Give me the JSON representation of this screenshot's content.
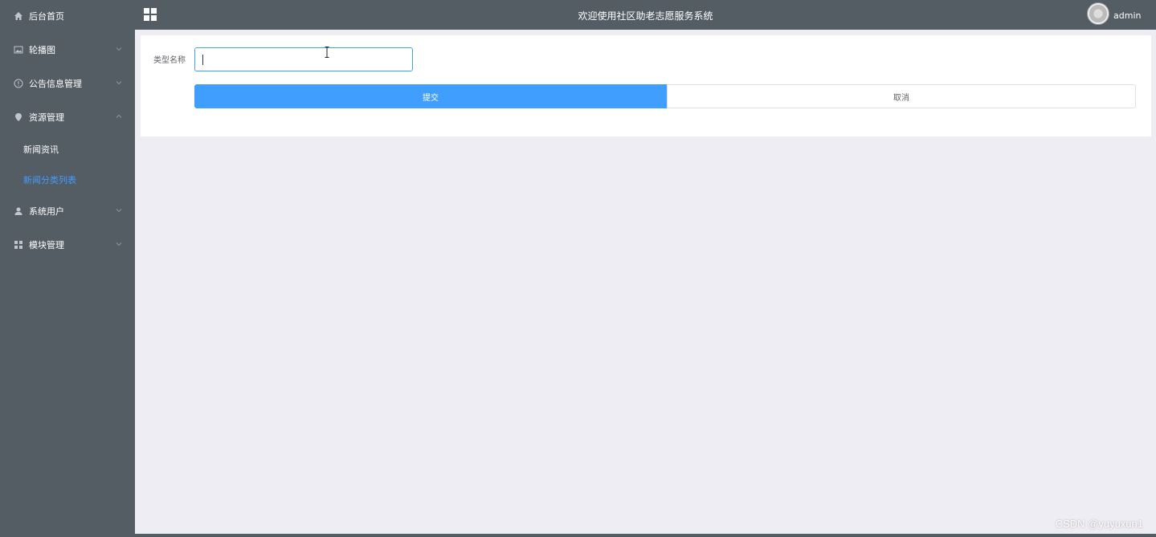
{
  "sidebar": {
    "items": [
      {
        "label": "后台首页",
        "icon": "home-icon"
      },
      {
        "label": "轮播图",
        "icon": "picture-icon"
      },
      {
        "label": "公告信息管理",
        "icon": "info-icon"
      },
      {
        "label": "资源管理",
        "icon": "location-icon"
      },
      {
        "label": "系统用户",
        "icon": "user-icon"
      },
      {
        "label": "模块管理",
        "icon": "menu-icon"
      }
    ],
    "sub_items": [
      {
        "label": "新闻资讯",
        "active": false
      },
      {
        "label": "新闻分类列表",
        "active": true
      }
    ]
  },
  "header": {
    "title": "欢迎使用社区助老志愿服务系统",
    "username": "admin"
  },
  "form": {
    "field_label": "类型名称",
    "field_value": "",
    "submit_label": "提交",
    "cancel_label": "取消"
  },
  "watermark": "CSDN @yuyuxun1",
  "colors": {
    "sidebar_bg": "#545c64",
    "accent": "#409eff",
    "content_bg": "#efedf4"
  }
}
